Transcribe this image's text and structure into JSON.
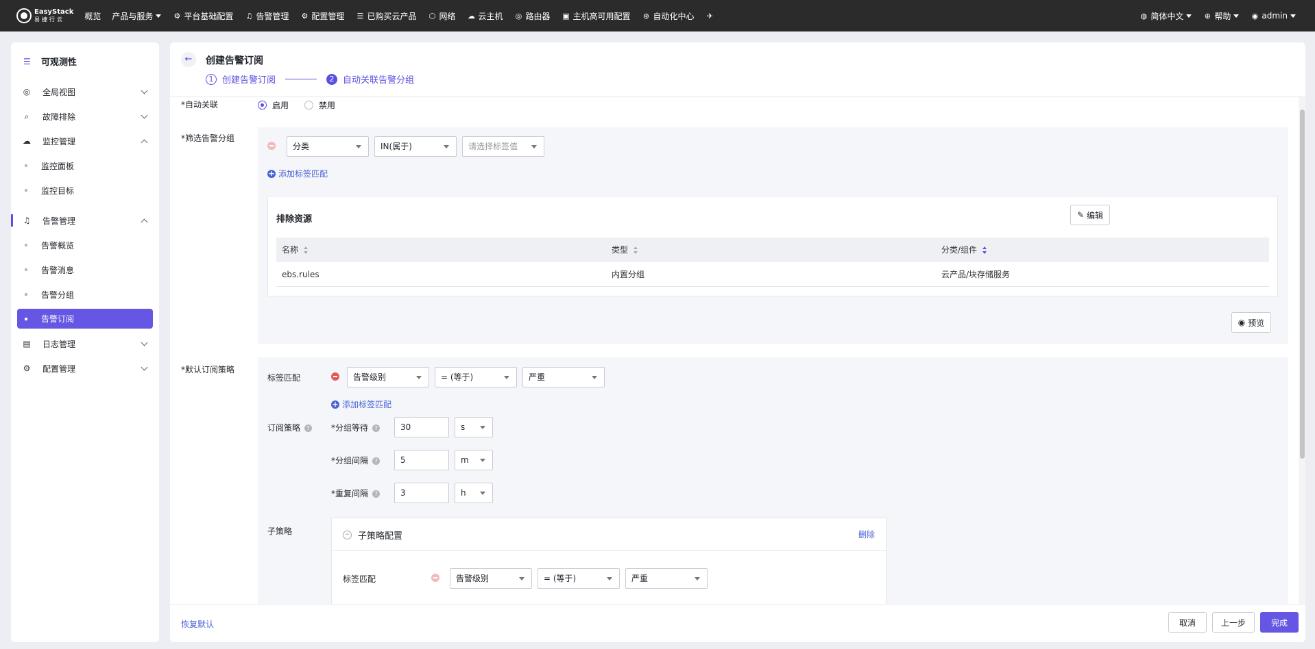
{
  "topbar": {
    "brand_line1": "EasyStack",
    "brand_line2": "易捷行云",
    "nav": [
      {
        "label": "概览",
        "icon": ""
      },
      {
        "label": "产品与服务",
        "icon": "caret-down"
      },
      {
        "label": "平台基础配置",
        "icon": "gear-icon"
      },
      {
        "label": "告警管理",
        "icon": "bell-icon"
      },
      {
        "label": "配置管理",
        "icon": "gear-icon"
      },
      {
        "label": "已购买云产品",
        "icon": "list-icon"
      },
      {
        "label": "网络",
        "icon": "network-icon"
      },
      {
        "label": "云主机",
        "icon": "cloud-icon"
      },
      {
        "label": "路由器",
        "icon": "router-icon"
      },
      {
        "label": "主机高可用配置",
        "icon": "host-icon"
      },
      {
        "label": "自动化中心",
        "icon": "automation-icon"
      }
    ],
    "language": "简体中文",
    "help": "帮助",
    "user": "admin"
  },
  "sidebar": {
    "title": "可观测性",
    "groups": [
      {
        "label": "全局视图",
        "expanded": false,
        "children": []
      },
      {
        "label": "故障排除",
        "expanded": false,
        "children": []
      },
      {
        "label": "监控管理",
        "expanded": true,
        "children": [
          "监控面板",
          "监控目标"
        ]
      },
      {
        "label": "告警管理",
        "expanded": true,
        "children": [
          "告警概览",
          "告警消息",
          "告警分组",
          "告警订阅"
        ]
      },
      {
        "label": "日志管理",
        "expanded": false,
        "children": []
      },
      {
        "label": "配置管理",
        "expanded": false,
        "children": []
      }
    ],
    "active_item": "告警订阅"
  },
  "page": {
    "title": "创建告警订阅",
    "steps": [
      {
        "num": "1",
        "label": "创建告警订阅"
      },
      {
        "num": "2",
        "label": "自动关联告警分组"
      }
    ],
    "current_step": 2
  },
  "form": {
    "auto_link": {
      "label": "*自动关联",
      "options": [
        "启用",
        "禁用"
      ],
      "selected": "启用"
    },
    "filter": {
      "label": "*筛选告警分组",
      "match": {
        "key": "分类",
        "op": "IN(属于)",
        "value_placeholder": "请选择标签值"
      },
      "add_label": "添加标签匹配",
      "exclude": {
        "title": "排除资源",
        "edit_label": "编辑",
        "columns": [
          "名称",
          "类型",
          "分类/组件"
        ],
        "rows": [
          [
            "ebs.rules",
            "内置分组",
            "云产品/块存储服务"
          ]
        ]
      },
      "preview_label": "预览"
    },
    "policy": {
      "label": "*默认订阅策略",
      "tag_label": "标签匹配",
      "match": {
        "key": "告警级别",
        "op": "= (等于)",
        "value": "严重"
      },
      "add_label": "添加标签匹配",
      "strategy_label": "订阅策略",
      "group_wait": {
        "label": "*分组等待",
        "value": "30",
        "unit": "s"
      },
      "group_interval": {
        "label": "*分组间隔",
        "value": "5",
        "unit": "m"
      },
      "repeat_interval": {
        "label": "*重复间隔",
        "value": "3",
        "unit": "h"
      },
      "sub_label": "子策略",
      "sub": {
        "title": "子策略配置",
        "delete_label": "删除",
        "tag_label": "标签匹配",
        "match": {
          "key": "告警级别",
          "op": "= (等于)",
          "value": "严重"
        }
      }
    }
  },
  "footer": {
    "reset": "恢复默认",
    "cancel": "取消",
    "prev": "上一步",
    "finish": "完成"
  },
  "colors": {
    "accent": "#6556e3",
    "link": "#4a63d6",
    "topbar": "#2b2b2b",
    "danger": "#e65a5a"
  }
}
